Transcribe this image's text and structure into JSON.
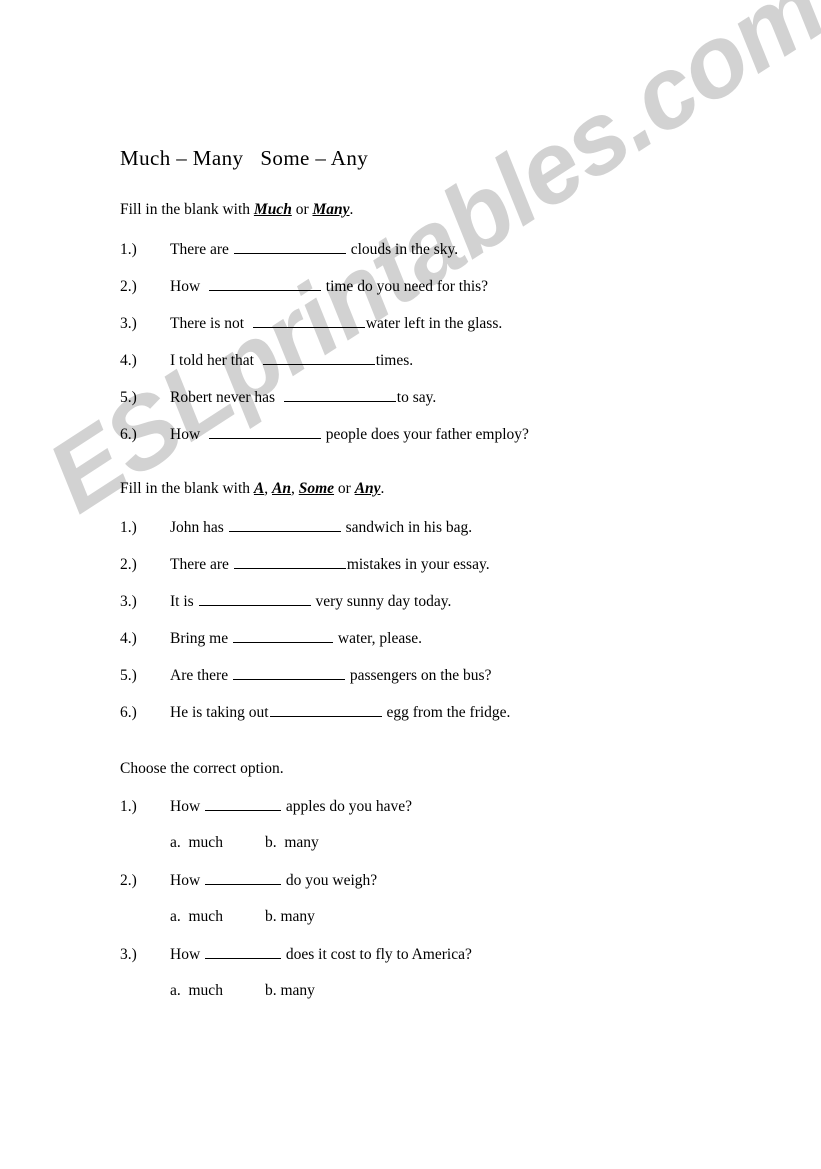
{
  "document": {
    "title": "Much – Many   Some – Any",
    "watermark": "ESLprintables.com",
    "watermark_color": "#d2d2d2"
  },
  "sections": [
    {
      "instruction_prefix": "Fill in the blank with ",
      "instruction_keywords": [
        "Much",
        "Many"
      ],
      "instruction_sep": " or ",
      "instruction_suffix": ".",
      "items": [
        {
          "number": "1.)",
          "before": "There are ",
          "after": " clouds in the sky.",
          "blank_width": 112
        },
        {
          "number": "2.)",
          "before": "How  ",
          "after": " time do you need for this?",
          "blank_width": 112
        },
        {
          "number": "3.)",
          "before": "There is not  ",
          "after": "water left in the glass.",
          "blank_width": 112
        },
        {
          "number": "4.)",
          "before": "I told her that  ",
          "after": "times.",
          "blank_width": 112
        },
        {
          "number": "5.)",
          "before": "Robert never has  ",
          "after": "to say.",
          "blank_width": 112
        },
        {
          "number": "6.)",
          "before": "How  ",
          "after": " people does your father employ?",
          "blank_width": 112
        }
      ]
    },
    {
      "instruction_prefix": "Fill in the blank with ",
      "instruction_keywords": [
        "A",
        "An",
        "Some",
        "Any"
      ],
      "instruction_sep": ", ",
      "instruction_suffix": ".",
      "items": [
        {
          "number": "1.)",
          "before": "John has ",
          "after": " sandwich in his bag.",
          "blank_width": 112
        },
        {
          "number": "2.)",
          "before": "There are ",
          "after": "mistakes in your essay.",
          "blank_width": 112
        },
        {
          "number": "3.)",
          "before": "It is ",
          "after": " very sunny day today.",
          "blank_width": 112
        },
        {
          "number": "4.)",
          "before": "Bring me ",
          "after": " water, please.",
          "blank_width": 100
        },
        {
          "number": "5.)",
          "before": "Are there ",
          "after": " passengers on the bus?",
          "blank_width": 112
        },
        {
          "number": "6.)",
          "before": "He is taking out",
          "after": " egg from the fridge.",
          "blank_width": 112
        }
      ]
    },
    {
      "instruction_plain": "Choose the correct option.",
      "items": [
        {
          "number": "1.)",
          "before": "How ",
          "after": " apples do you have?",
          "blank_width": 76,
          "option_a": "a.  much",
          "option_b": "b.  many"
        },
        {
          "number": "2.)",
          "before": "How ",
          "after": " do you weigh?",
          "blank_width": 76,
          "option_a": "a.  much",
          "option_b": "b. many"
        },
        {
          "number": "3.)",
          "before": "How ",
          "after": " does it cost to fly to America?",
          "blank_width": 76,
          "option_a": "a.  much",
          "option_b": "b. many"
        }
      ]
    }
  ]
}
